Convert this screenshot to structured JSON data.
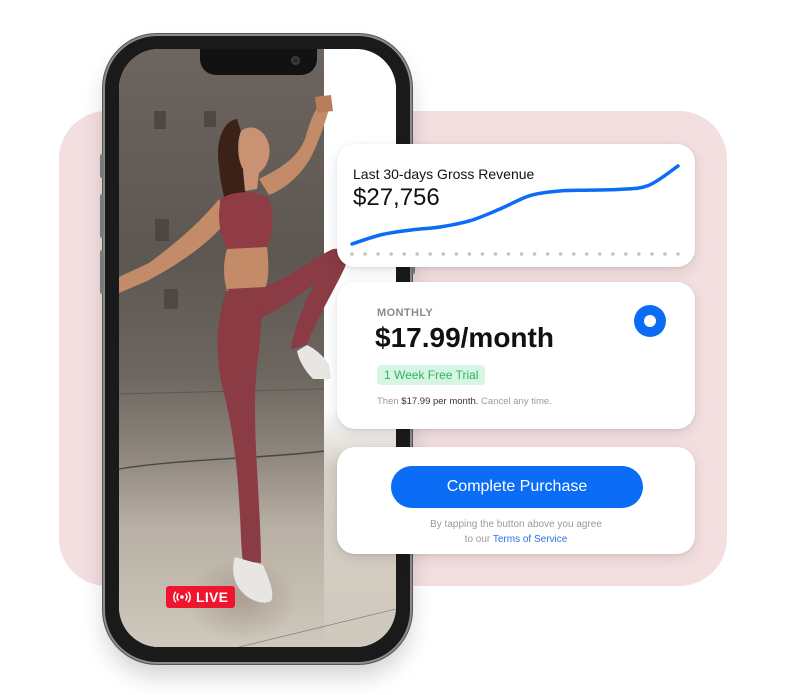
{
  "revenue_card": {
    "title": "Last 30-days Gross Revenue",
    "value": "$27,756",
    "line_color": "#0b6cf5",
    "trend": [
      0.0,
      0.12,
      0.18,
      0.22,
      0.3,
      0.45,
      0.62,
      0.68,
      0.69,
      0.7,
      0.75,
      1.0
    ],
    "dot_count": 26
  },
  "plan_card": {
    "label": "MONTHLY",
    "price": "$17.99/month",
    "trial_badge": "1 Week Free Trial",
    "note_prefix": "Then",
    "note_price": "$17.99 per month.",
    "note_suffix": "Cancel any time.",
    "selected": true
  },
  "purchase_card": {
    "button_label": "Complete Purchase",
    "terms_text": "By tapping the button above you agree",
    "terms_prefix": "to our",
    "terms_link": "Terms of Service"
  },
  "phone": {
    "live_badge": "LIVE"
  },
  "colors": {
    "accent": "#0b6cf5",
    "live": "#f0142e",
    "trial_bg": "#d6f5e3",
    "trial_text": "#2cb566",
    "backdrop": "#f3dfe0"
  }
}
